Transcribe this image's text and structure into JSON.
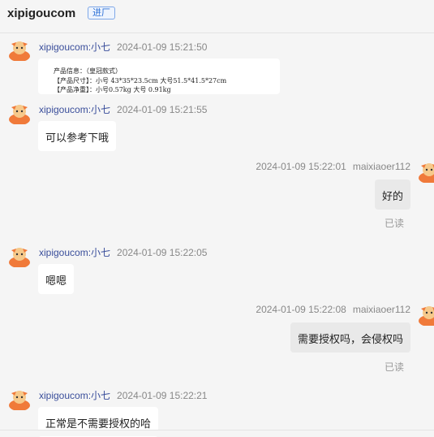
{
  "header": {
    "title": "xipigoucom",
    "badge": "进厂"
  },
  "messages": [
    {
      "name": "xipigoucom:小七",
      "time": "2024-01-09 15:21:50",
      "image_lines": [
        "产品信息：（皇冠款式）",
        "【产品尺寸】：小号 43*35*23.5cm   大号51.5*41.5*27cm",
        "【产品净重】：小号0.57kg    大号 0.91kg"
      ]
    },
    {
      "name": "xipigoucom:小七",
      "time": "2024-01-09 15:21:55",
      "text": "可以参考下哦"
    },
    {
      "name": "maixiaoer112",
      "time": "2024-01-09 15:22:01",
      "text": "好的",
      "status": "已读"
    },
    {
      "name": "xipigoucom:小七",
      "time": "2024-01-09 15:22:05",
      "text": "嗯嗯"
    },
    {
      "name": "maixiaoer112",
      "time": "2024-01-09 15:22:08",
      "text": "需要授权吗，会侵权吗",
      "status": "已读"
    },
    {
      "name": "xipigoucom:小七",
      "time": "2024-01-09 15:22:21",
      "text": "正常是不需要授权的哈"
    }
  ],
  "colors": {
    "name_link": "#3a4e9b",
    "avatar": "#f07a3a",
    "badge": "#2b6fd6"
  },
  "icons": {
    "avatar": "cartoon-avatar-icon"
  }
}
